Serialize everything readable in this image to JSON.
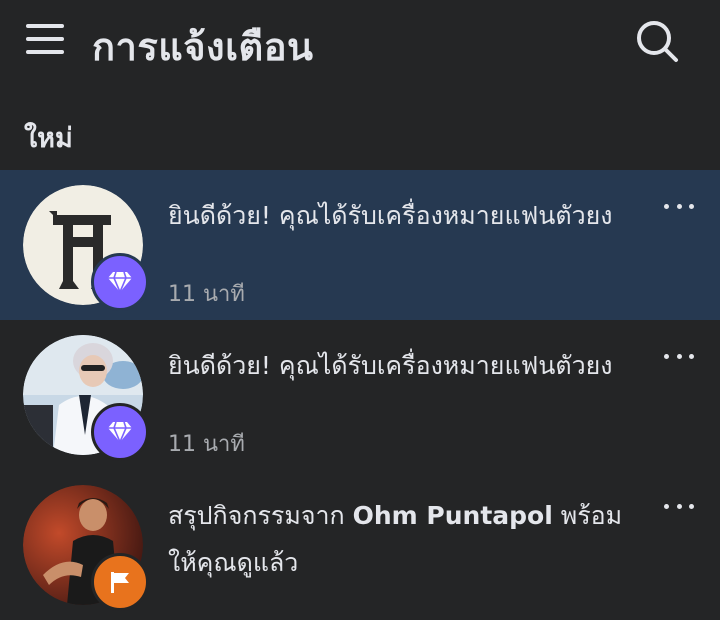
{
  "header": {
    "title": "การแจ้งเตือน",
    "menu_icon": "hamburger-menu-icon",
    "search_icon": "search-icon"
  },
  "section": {
    "label": "ใหม่"
  },
  "notifications": [
    {
      "text": "ยินดีด้วย! คุณได้รับเครื่องหมายแฟนตัวยง",
      "time": "11 นาที",
      "unread": true,
      "avatar": "page-logo-avatar",
      "badge_icon": "diamond-icon",
      "badge_color": "#7b61ff"
    },
    {
      "text": "ยินดีด้วย! คุณได้รับเครื่องหมายแฟนตัวยง",
      "time": "11 นาที",
      "unread": false,
      "avatar": "person-avatar",
      "badge_icon": "diamond-icon",
      "badge_color": "#7b61ff"
    },
    {
      "text_prefix": "สรุปกิจกรรมจาก ",
      "text_name": "Ohm Puntapol",
      "text_suffix": " พร้อมให้คุณดูแล้ว",
      "unread": false,
      "avatar": "person-avatar",
      "badge_icon": "flag-icon",
      "badge_color": "#e8731d"
    }
  ],
  "colors": {
    "background": "#242526",
    "unread_background": "#263951",
    "text": "#e4e6eb",
    "secondary_text": "#a8abaf"
  }
}
